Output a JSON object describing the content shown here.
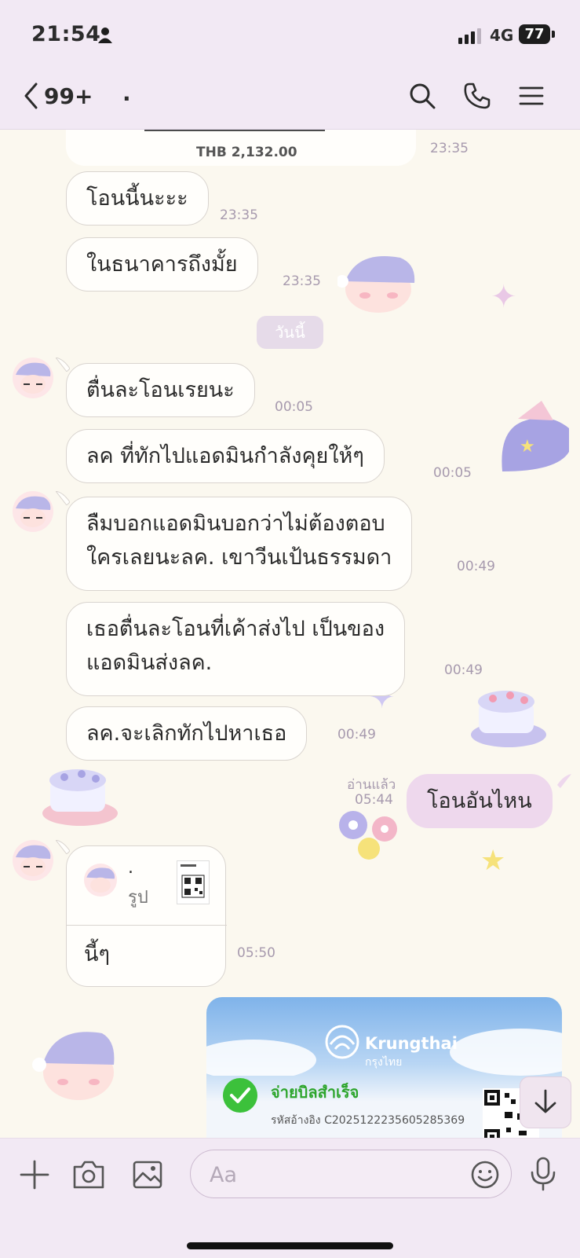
{
  "status_bar": {
    "time": "21:54",
    "network": "4G",
    "battery": "77"
  },
  "header": {
    "back_count": "99+",
    "chat_name": "."
  },
  "messages": [
    {
      "text": "THB 2,132.00",
      "time": "23:35"
    },
    {
      "text": "โอนนี้นะะะ",
      "time": "23:35"
    },
    {
      "text": "ในธนาคารถึงมั้ย",
      "time": "23:35"
    },
    {
      "text": "ตื่นละโอนเรยนะ",
      "time": "00:05"
    },
    {
      "text": "ลค ที่ทักไปแอดมินกำลังคุยให้ๆ",
      "time": "00:05"
    },
    {
      "line1": "ลืมบอกแอดมินบอกว่าไม่ต้องตอบ",
      "line2": "ใครเลยนะลค. เขาวีนเป้นธรรมดา",
      "time": "00:49"
    },
    {
      "line1": "เธอตื่นละโอนที่เค้าส่งไป เป็นของ",
      "line2": "แอดมินส่งลค.",
      "time": "00:49"
    },
    {
      "text": "ลค.จะเลิกทักไปหาเธอ",
      "time": "00:49"
    },
    {
      "text": "โอนอันไหน",
      "read": "อ่านแล้ว",
      "time": "05:44"
    },
    {
      "sender_dot": ".",
      "media_label": "รูป",
      "text": "นี้ๆ",
      "time": "05:50"
    }
  ],
  "date_separator": "วันนี้",
  "receipt": {
    "bank": "Krungthai",
    "bank_thai": "กรุงไทย",
    "status": "จ่ายบิลสำเร็จ",
    "ref": "รหัสอ้างอิง C2025122235605285369"
  },
  "input": {
    "placeholder": "Aa"
  },
  "colors": {
    "bar": "#f2e9f4",
    "my_bubble": "#eed8ed",
    "success": "#3cc13b"
  }
}
